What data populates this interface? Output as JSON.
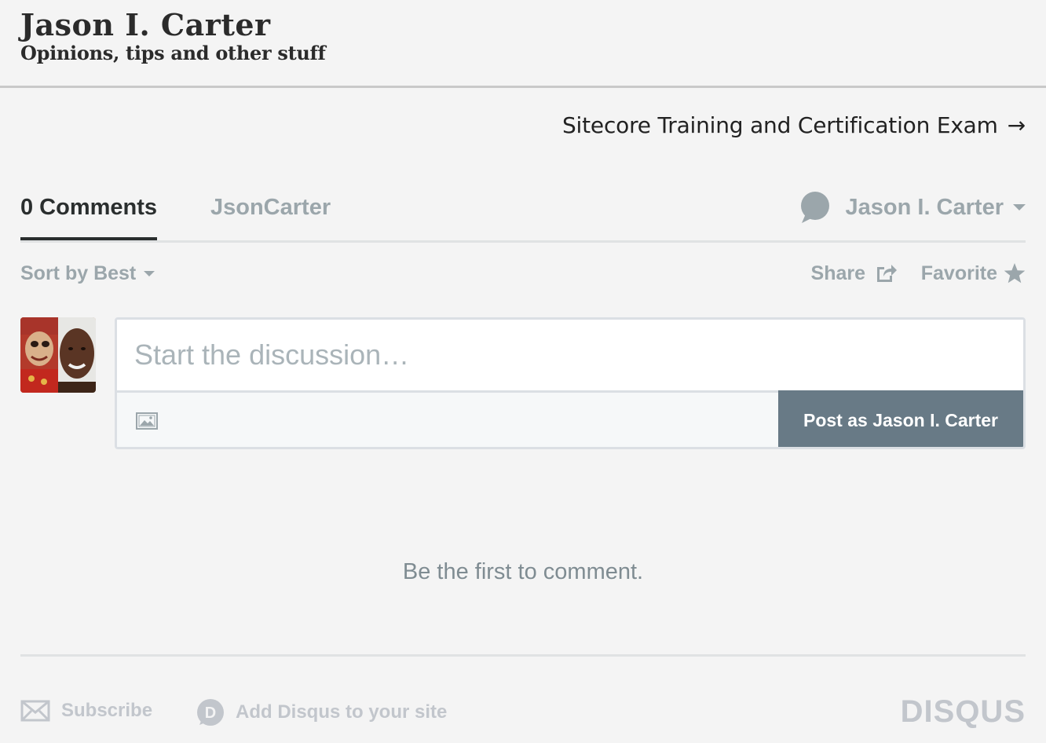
{
  "header": {
    "title": "Jason I. Carter",
    "tagline": "Opinions, tips and other stuff"
  },
  "next_post": {
    "label": "Sitecore Training and Certification Exam",
    "arrow": "→"
  },
  "disqus": {
    "tabs": {
      "comments": "0 Comments",
      "community": "JsonCarter"
    },
    "user_menu": {
      "name": "Jason I. Carter",
      "icon": "chat-bubble-icon"
    },
    "sort": {
      "label": "Sort by Best"
    },
    "share": {
      "label": "Share",
      "icon": "share-icon"
    },
    "favorite": {
      "label": "Favorite",
      "icon": "star-icon"
    },
    "composer": {
      "placeholder": "Start the discussion…",
      "post_button": "Post as Jason I. Carter",
      "image_icon": "image-icon"
    },
    "empty_message": "Be the first to comment.",
    "footer": {
      "subscribe": "Subscribe",
      "add_disqus": "Add Disqus to your site",
      "logo": "DISQUS"
    }
  },
  "colors": {
    "accent_dark": "#2a2e2e",
    "muted": "#9ba6ab",
    "button": "#687a86",
    "footer_muted": "#c2c6cc"
  }
}
